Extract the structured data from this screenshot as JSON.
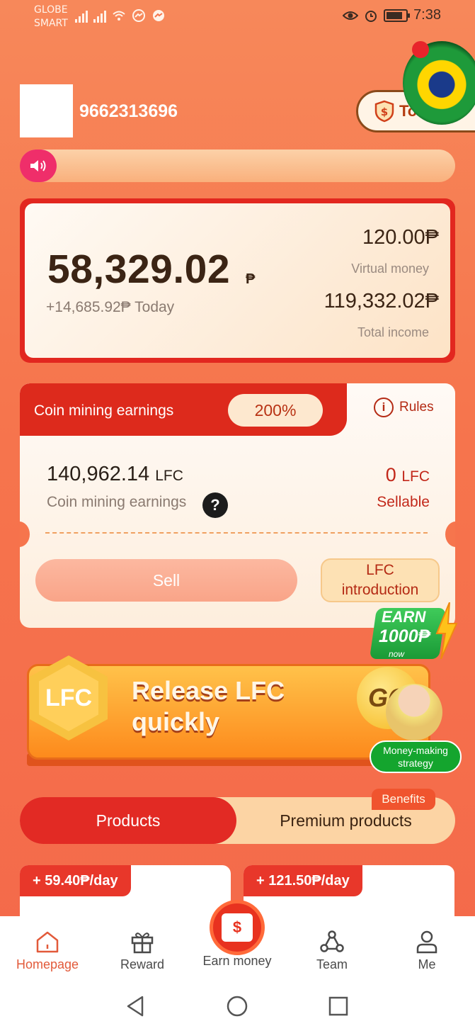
{
  "status_bar": {
    "carrier_line1": "GLOBE",
    "carrier_line2": "SMART",
    "time": "7:38"
  },
  "header": {
    "user_id": "9662313696",
    "topup_label": "To"
  },
  "balance": {
    "main": "58,329.02",
    "currency": "₱",
    "today": "+14,685.92₱ Today",
    "virtual_value": "120.00₱",
    "virtual_label": "Virtual money",
    "income_value": "119,332.02₱",
    "income_label": "Total income"
  },
  "mining": {
    "tab_label": "Coin mining earnings",
    "percent": "200%",
    "rules_label": "Rules",
    "amount": "140,962.14",
    "amount_unit": "LFC",
    "amount_label": "Coin mining earnings",
    "sellable_amount": "0",
    "sellable_unit": "LFC",
    "sellable_label": "Sellable",
    "sell_button": "Sell",
    "intro_button_line1": "LFC",
    "intro_button_line2": "introduction"
  },
  "earn_badge": {
    "title": "EARN",
    "amount": "1000₱",
    "sub": "now"
  },
  "banner": {
    "hex_label": "LFC",
    "title_line1": "Release LFC",
    "title_line2": "quickly",
    "go_label": "GO",
    "strategy_line1": "Money-making",
    "strategy_line2": "strategy"
  },
  "product_tabs": {
    "products": "Products",
    "premium": "Premium products",
    "benefits": "Benefits"
  },
  "products": [
    {
      "rate": "+ 59.40₱/day"
    },
    {
      "rate": "+ 121.50₱/day"
    }
  ],
  "nav": {
    "home": "Homepage",
    "reward": "Reward",
    "earn": "Earn money",
    "earn_icon": "$",
    "team": "Team",
    "me": "Me"
  }
}
